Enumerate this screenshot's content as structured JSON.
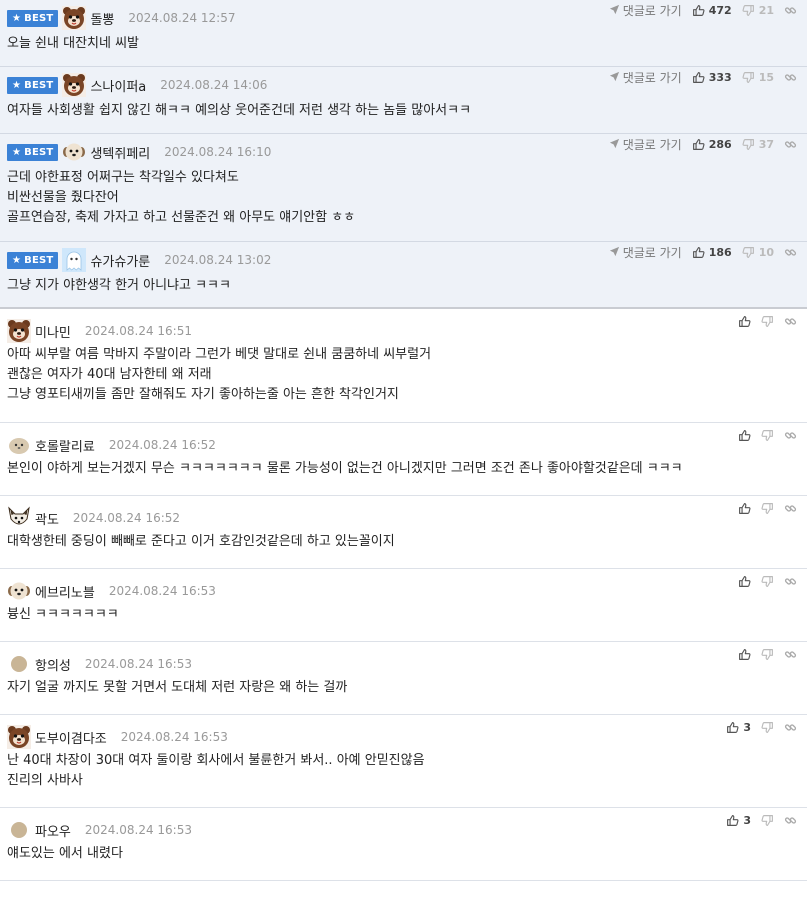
{
  "best_badge": "BEST",
  "reply_link": "댓글로 가기",
  "best_comments": [
    {
      "nick": "돌뽕",
      "date": "2024.08.24 12:57",
      "likes": "472",
      "dislikes": "21",
      "avatar": "bear-icon",
      "lines": [
        "오늘 쉰내 대잔치네 씨발"
      ]
    },
    {
      "nick": "스나이퍼a",
      "date": "2024.08.24 14:06",
      "likes": "333",
      "dislikes": "15",
      "avatar": "bear-icon",
      "lines": [
        "여자들 사회생활 쉽지 않긴 해ㅋㅋ 예의상 웃어준건데 저런 생각 하는 놈들 많아서ㅋㅋ"
      ]
    },
    {
      "nick": "생텍쥐페리",
      "date": "2024.08.24 16:10",
      "likes": "286",
      "dislikes": "37",
      "avatar": "puppy-icon",
      "lines": [
        "근데 야한표정 어쩌구는 착각일수 있다쳐도",
        "비싼선물을 줬다잔어",
        "골프연습장, 축제 가자고 하고 선물준건 왜 아무도 얘기안함 ㅎㅎ"
      ]
    },
    {
      "nick": "슈가슈가룬",
      "date": "2024.08.24 13:02",
      "likes": "186",
      "dislikes": "10",
      "avatar": "ghost-icon",
      "lines": [
        "그냥 지가 야한생각 한거 아니냐고 ㅋㅋㅋ"
      ]
    }
  ],
  "comments": [
    {
      "nick": "미나민",
      "date": "2024.08.24 16:51",
      "likes": "",
      "avatar": "bear-icon",
      "lines": [
        "아따 씨부랄 여름 막바지 주말이라 그런가 베댓 말대로 쉰내 쿰쿰하네 씨부럴거",
        "괜찮은 여자가 40대 남자한테 왜 저래",
        "그냥 영포티새끼들 좀만 잘해줘도 자기 좋아하는줄 아는 흔한 착각인거지"
      ]
    },
    {
      "nick": "호롤랄리료",
      "date": "2024.08.24 16:52",
      "likes": "",
      "avatar": "blob-icon",
      "lines": [
        "본인이 야하게 보는거겠지 무슨 ㅋㅋㅋㅋㅋㅋㅋ 물론 가능성이 없는건 아니겠지만 그러면 조건 존나 좋아야할것같은데 ㅋㅋㅋ"
      ]
    },
    {
      "nick": "곽도",
      "date": "2024.08.24 16:52",
      "likes": "",
      "avatar": "fox-icon",
      "lines": [
        "대학생한테 중딩이 빼빼로 준다고 이거 호감인것같은데 하고 있는꼴이지"
      ]
    },
    {
      "nick": "에브리노블",
      "date": "2024.08.24 16:53",
      "likes": "",
      "avatar": "puppy-icon",
      "lines": [
        "븅신 ㅋㅋㅋㅋㅋㅋㅋ"
      ]
    },
    {
      "nick": "항의성",
      "date": "2024.08.24 16:53",
      "likes": "",
      "avatar": "circle-icon",
      "lines": [
        "자기 얼굴 까지도 못할 거면서 도대체 저런 자랑은 왜 하는 걸까"
      ]
    },
    {
      "nick": "도부이겸다조",
      "date": "2024.08.24 16:53",
      "likes": "3",
      "avatar": "bear-icon",
      "lines": [
        "난 40대 차장이 30대 여자 둘이랑 회사에서 불륜한거 봐서.. 아예 안믿진않음",
        "진리의 사바사"
      ]
    },
    {
      "nick": "파오우",
      "date": "2024.08.24 16:53",
      "likes": "3",
      "avatar": "circle-icon",
      "lines": [
        "얘도있는 에서 내렸다"
      ]
    }
  ],
  "colors": {
    "best_bg": "#eef2f8",
    "badge": "#3b82d6",
    "date": "#999999"
  }
}
